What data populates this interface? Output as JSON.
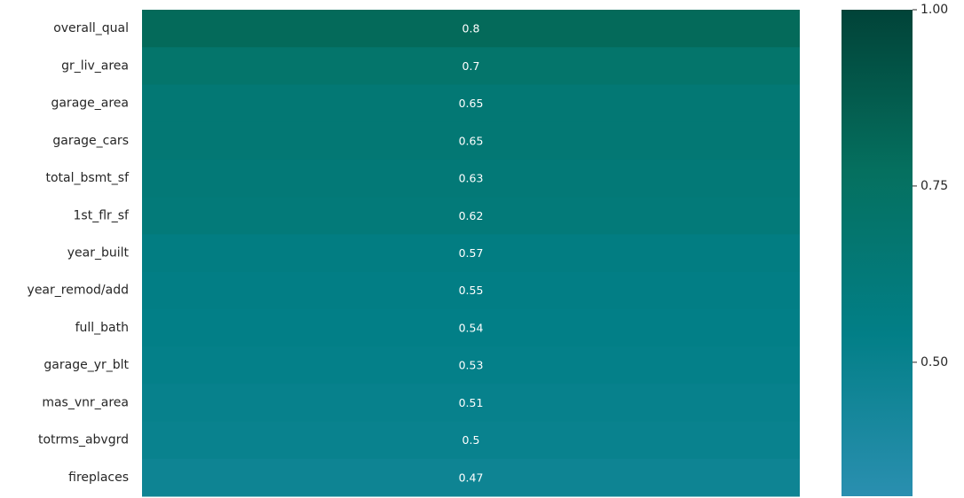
{
  "chart_data": {
    "type": "heatmap",
    "columns": [
      ""
    ],
    "rows": [
      {
        "label": "overall_qual",
        "value": 0.8
      },
      {
        "label": "gr_liv_area",
        "value": 0.7
      },
      {
        "label": "garage_area",
        "value": 0.65
      },
      {
        "label": "garage_cars",
        "value": 0.65
      },
      {
        "label": "total_bsmt_sf",
        "value": 0.63
      },
      {
        "label": "1st_flr_sf",
        "value": 0.62
      },
      {
        "label": "year_built",
        "value": 0.57
      },
      {
        "label": "year_remod/add",
        "value": 0.55
      },
      {
        "label": "full_bath",
        "value": 0.54
      },
      {
        "label": "garage_yr_blt",
        "value": 0.53
      },
      {
        "label": "mas_vnr_area",
        "value": 0.51
      },
      {
        "label": "totrms_abvgrd",
        "value": 0.5
      },
      {
        "label": "fireplaces",
        "value": 0.47
      }
    ],
    "colorbar": {
      "range": [
        0.31,
        1.0
      ],
      "ticks": [
        {
          "value": 1.0,
          "label": "1.00"
        },
        {
          "value": 0.75,
          "label": "0.75"
        },
        {
          "value": 0.5,
          "label": "0.50"
        }
      ],
      "colormap": [
        "#2a8fb0",
        "#027f87",
        "#05705f",
        "#014338"
      ]
    },
    "annotations": true,
    "annotation_color": "#ffffff",
    "grid": false,
    "legend": "colorbar-right"
  }
}
